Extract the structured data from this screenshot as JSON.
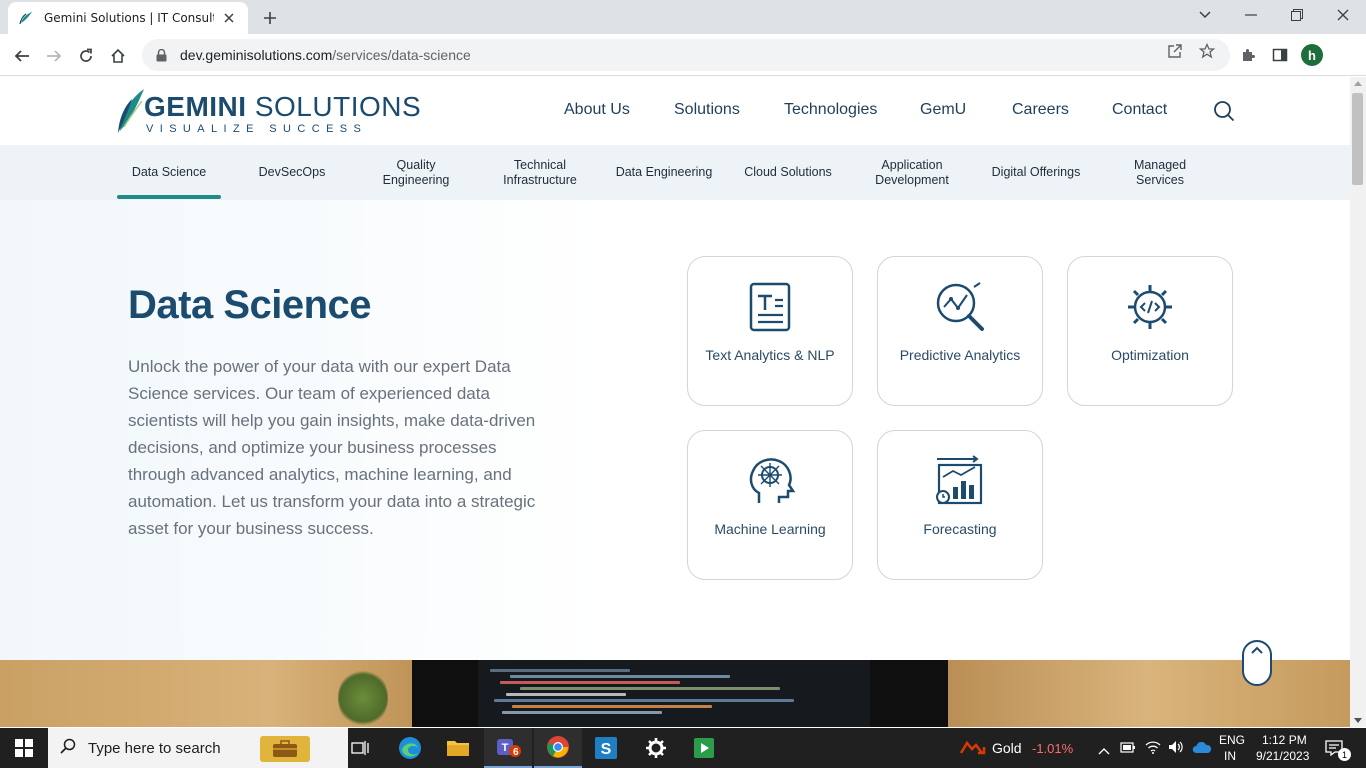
{
  "browser": {
    "tab_title": "Gemini Solutions | IT Consulting",
    "url_domain": "dev.geminisolutions.com",
    "url_path": "/services/data-science",
    "profile_initial": "h"
  },
  "site": {
    "logo_word_bold": "GEMINI",
    "logo_word_light": " SOLUTIONS",
    "logo_tagline": "VISUALIZE SUCCESS",
    "nav": [
      "About Us",
      "Solutions",
      "Technologies",
      "GemU",
      "Careers",
      "Contact"
    ],
    "subnav": [
      "Data Science",
      "DevSecOps",
      "Quality\nEngineering",
      "Technical\nInfrastructure",
      "Data Engineering",
      "Cloud Solutions",
      "Application\nDevelopment",
      "Digital Offerings",
      "Managed\nServices"
    ],
    "active_subnav": "Data Science"
  },
  "hero": {
    "title": "Data Science",
    "description": "Unlock the power of your data with our expert Data Science services. Our team of experienced data scientists will help you gain insights, make data-driven decisions, and optimize your business processes through advanced analytics, machine learning, and automation. Let us transform your data into a strategic asset for your business success.",
    "cards": [
      {
        "label": "Text Analytics & NLP",
        "icon": "text-document-icon"
      },
      {
        "label": "Predictive Analytics",
        "icon": "magnifier-chart-icon"
      },
      {
        "label": "Optimization",
        "icon": "gear-code-icon"
      },
      {
        "label": "Machine Learning",
        "icon": "head-brain-icon"
      },
      {
        "label": "Forecasting",
        "icon": "bar-chart-clock-icon"
      }
    ]
  },
  "taskbar": {
    "search_placeholder": "Type here to search",
    "teams_badge": "6",
    "stock_name": "Gold",
    "stock_change": "-1.01%",
    "lang_top": "ENG",
    "lang_bottom": "IN",
    "time": "1:12 PM",
    "date": "9/21/2023",
    "notification_count": "1"
  },
  "colors": {
    "brand": "#1b4b6e",
    "accent": "#1f8a86",
    "stock_negative": "#ff6b6b"
  }
}
